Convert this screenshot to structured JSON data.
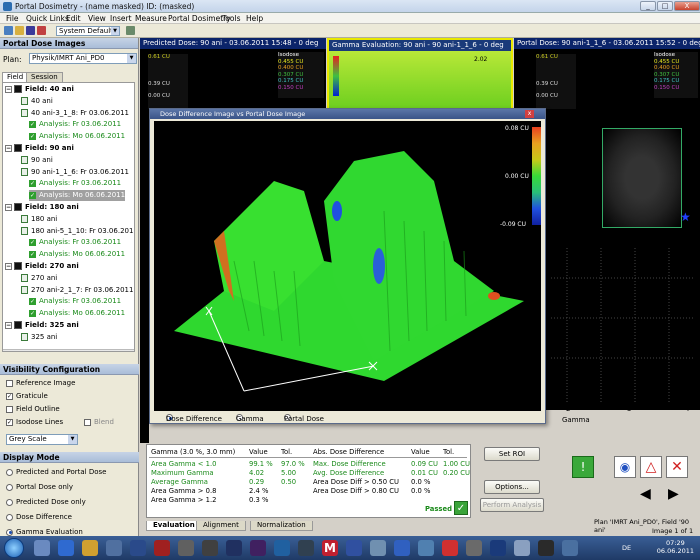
{
  "window": {
    "title": "Portal Dosimetry - (name masked)  ID: (masked)",
    "controls": [
      "_",
      "□",
      "X"
    ]
  },
  "menu": [
    "File",
    "Quick Links",
    "Edit",
    "View",
    "Insert",
    "Measure",
    "Portal Dosimetry",
    "Tools",
    "Help"
  ],
  "toolbar": {
    "preset": "System Default"
  },
  "left": {
    "header": "Portal Dose Images",
    "plan_label": "Plan:",
    "plan_value": "Physik/IMRT Ani_PD0",
    "tabs": [
      "Field",
      "Session"
    ],
    "tree": [
      {
        "kind": "field",
        "text": "Field: 40 ani"
      },
      {
        "kind": "image",
        "text": "40 ani"
      },
      {
        "kind": "image",
        "text": "40 ani-3_1_8: Fr 03.06.2011"
      },
      {
        "kind": "analysis",
        "text": "Analysis: Fr 03.06.2011"
      },
      {
        "kind": "analysis",
        "text": "Analysis: Mo 06.06.2011"
      },
      {
        "kind": "field",
        "text": "Field: 90 ani"
      },
      {
        "kind": "image",
        "text": "90 ani"
      },
      {
        "kind": "image",
        "text": "90 ani-1_1_6: Fr 03.06.2011"
      },
      {
        "kind": "analysis",
        "text": "Analysis: Fr 03.06.2011"
      },
      {
        "kind": "analysis-sel",
        "text": "Analysis: Mo 06.06.2011"
      },
      {
        "kind": "field",
        "text": "Field: 180 ani"
      },
      {
        "kind": "image",
        "text": "180 ani"
      },
      {
        "kind": "image",
        "text": "180 ani-5_1_10: Fr 03.06.2011"
      },
      {
        "kind": "analysis",
        "text": "Analysis: Fr 03.06.2011"
      },
      {
        "kind": "analysis",
        "text": "Analysis: Mo 06.06.2011"
      },
      {
        "kind": "field",
        "text": "Field: 270 ani"
      },
      {
        "kind": "image",
        "text": "270 ani"
      },
      {
        "kind": "image",
        "text": "270 ani-2_1_7: Fr 03.06.2011"
      },
      {
        "kind": "analysis",
        "text": "Analysis: Fr 03.06.2011"
      },
      {
        "kind": "analysis",
        "text": "Analysis: Mo 06.06.2011"
      },
      {
        "kind": "field",
        "text": "Field: 325 ani"
      },
      {
        "kind": "image",
        "text": "325 ani"
      }
    ],
    "visibility_header": "Visibility Configuration",
    "visibility": [
      {
        "label": "Reference Image",
        "checked": false
      },
      {
        "label": "Graticule",
        "checked": true
      },
      {
        "label": "Field Outline",
        "checked": false
      },
      {
        "label": "Isodose Lines",
        "checked": true
      },
      {
        "label": "Blend",
        "checked": false
      }
    ],
    "greyscale": "Grey Scale",
    "display_header": "Display Mode",
    "display_modes": [
      {
        "label": "Predicted and Portal Dose",
        "on": false
      },
      {
        "label": "Portal Dose only",
        "on": false
      },
      {
        "label": "Predicted Dose only",
        "on": false
      },
      {
        "label": "Dose Difference",
        "on": false
      },
      {
        "label": "Gamma Evaluation",
        "on": true
      }
    ]
  },
  "panes": [
    {
      "title": "Predicted Dose: 90 ani - 03.06.2011 15:48 - 0 deg",
      "legend": [
        "0.61 CU",
        "0.39 CU",
        "0.00 CU"
      ],
      "isodose": [
        "Isodose",
        "0.455 CU",
        "0.400 CU",
        "0.307 CU",
        "0.175 CU",
        "0.150 CU"
      ]
    },
    {
      "title": "Gamma Evaluation: 90 ani - 90 ani-1_1_6 - 0 deg",
      "legend": [
        "2.02"
      ]
    },
    {
      "title": "Portal Dose: 90 ani-1_1_6 - 03.06.2011 15:52 - 0 deg",
      "legend": [
        "0.61 CU",
        "0.39 CU",
        "0.00 CU"
      ],
      "isodose": [
        "Isodose",
        "0.455 CU",
        "0.400 CU",
        "0.307 CU",
        "0.175 CU",
        "0.150 CU"
      ]
    }
  ],
  "floating": {
    "title": "Dose Difference Image vs Portal Dose Image",
    "scale": [
      "0.08 CU",
      "0.00 CU",
      "-0.09 CU"
    ],
    "view_modes": [
      {
        "label": "Dose Difference",
        "on": true
      },
      {
        "label": "Gamma",
        "on": false
      },
      {
        "label": "Portal Dose",
        "on": false
      }
    ]
  },
  "stats": {
    "gamma_header": "Gamma (3.0 %, 3.0 mm)",
    "value_header": "Value",
    "tol_header": "Tol.",
    "abs_header": "Abs. Dose Difference",
    "gamma_rows": [
      {
        "label": "Area Gamma < 1.0",
        "value": "99.1 %",
        "tol": "97.0 %",
        "green": true
      },
      {
        "label": "Maximum Gamma",
        "value": "4.02",
        "tol": "5.00",
        "green": true
      },
      {
        "label": "Average Gamma",
        "value": "0.29",
        "tol": "0.50",
        "green": true
      },
      {
        "label": "Area Gamma > 0.8",
        "value": "2.4 %",
        "tol": "",
        "green": false
      },
      {
        "label": "Area Gamma > 1.2",
        "value": "0.3 %",
        "tol": "",
        "green": false
      }
    ],
    "abs_rows": [
      {
        "label": "Max. Dose Difference",
        "value": "0.09 CU",
        "tol": "1.00 CU",
        "green": true
      },
      {
        "label": "Avg. Dose Difference",
        "value": "0.01 CU",
        "tol": "0.20 CU",
        "green": true
      },
      {
        "label": "Area Dose Diff > 0.50 CU",
        "value": "0.0 %",
        "tol": "",
        "green": false
      },
      {
        "label": "Area Dose Diff > 0.80 CU",
        "value": "0.0 %",
        "tol": "",
        "green": false
      }
    ],
    "passed": "Passed"
  },
  "buttons": {
    "set_roi": "Set ROI",
    "options": "Options...",
    "perform": "Perform Analysis"
  },
  "bottom_tabs": [
    "Evaluation",
    "Alignment",
    "Normalization"
  ],
  "graph": {
    "xlabel": "Gamma",
    "ticks": [
      "2",
      "3",
      "4"
    ]
  },
  "statusbar": {
    "plan": "Plan 'IMRT Ani_PD0', Field '90 ani'",
    "image": "Image 1 of 1"
  },
  "taskbar": {
    "lang": "DE",
    "time": "07:29",
    "date": "06.06.2011"
  }
}
